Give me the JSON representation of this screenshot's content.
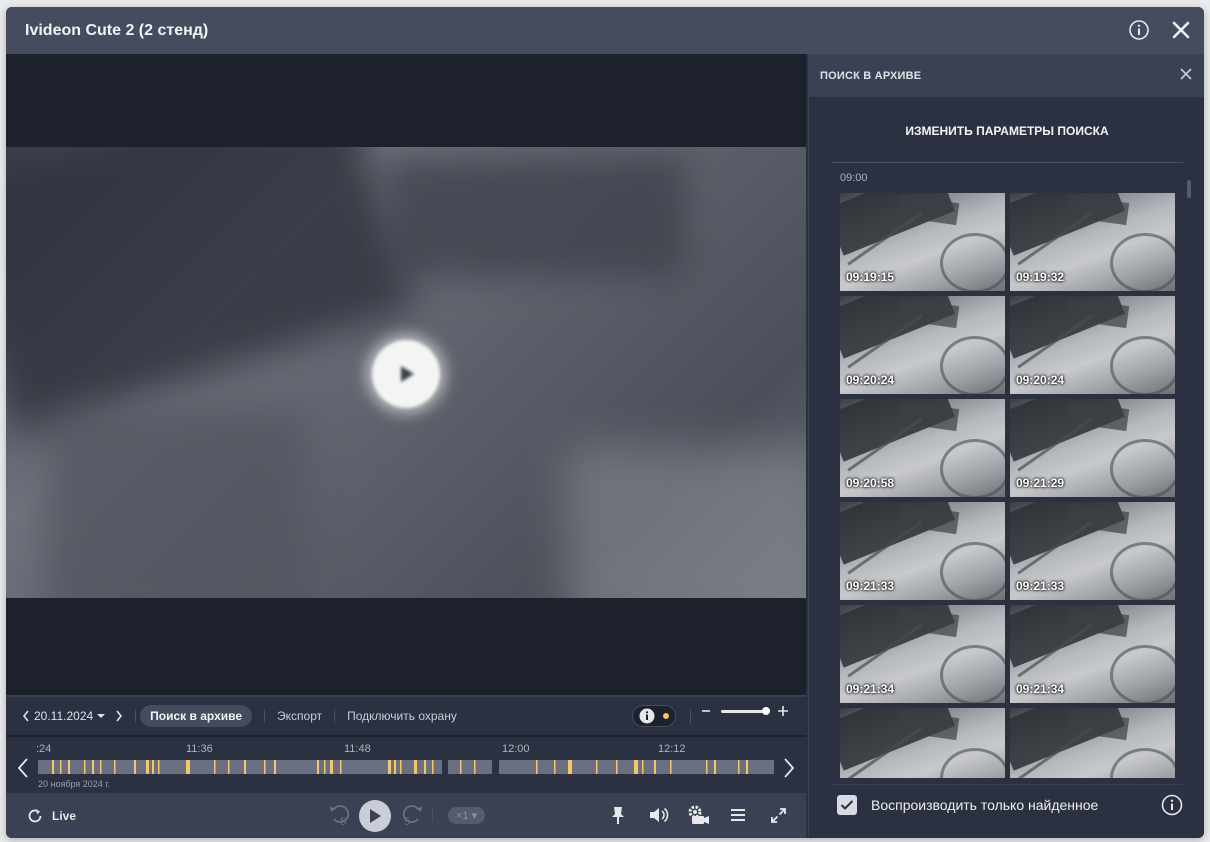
{
  "window": {
    "title": "Ivideon Cute 2 (2 стенд)"
  },
  "controls": {
    "date": "20.11.2024",
    "search_tab": "Поиск в архиве",
    "export_tab": "Экспорт",
    "arm_tab": "Подключить охрану"
  },
  "timeline": {
    "ticks": [
      ":24",
      "11:36",
      "11:48",
      "12:00",
      "12:12"
    ],
    "date_caption": "20 ноября 2024 г.",
    "event_color": "#f4c56b"
  },
  "bottom": {
    "live_label": "Live",
    "skip_seconds": "5",
    "speed": "×1"
  },
  "panel": {
    "title": "ПОИСК В АРХИВЕ",
    "change_params": "ИЗМЕНИТЬ ПАРАМЕТРЫ ПОИСКА",
    "hour_label": "09:00",
    "results": [
      "09:19:15",
      "09:19:32",
      "09:20:24",
      "09:20:24",
      "09:20:58",
      "09:21:29",
      "09:21:33",
      "09:21:33",
      "09:21:34",
      "09:21:34",
      "",
      ""
    ],
    "play_only_found": "Воспроизводить только найденное",
    "play_only_found_checked": true
  },
  "colors": {
    "accent_event": "#f4c56b",
    "panel_bg": "#2b3140",
    "title_bg": "#454c5d"
  }
}
